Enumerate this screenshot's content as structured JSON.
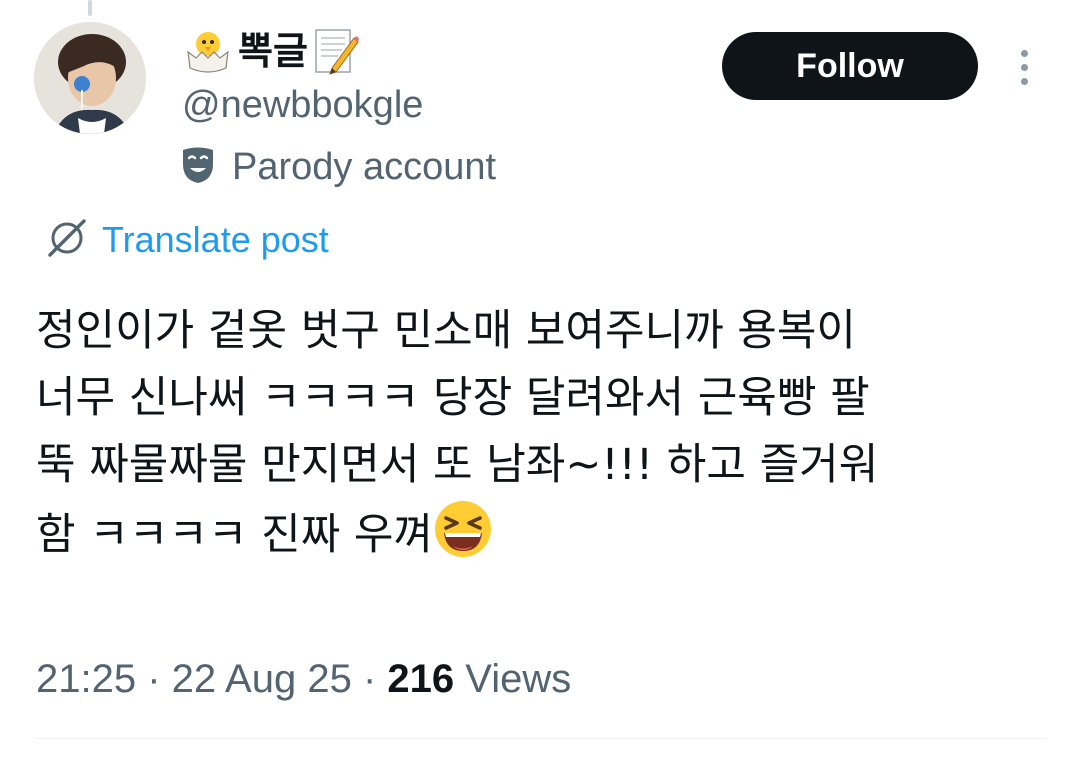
{
  "author": {
    "display_name": "뽁글",
    "handle": "@newbbokgle",
    "account_label": "Parody account",
    "name_emoji_left": "hatching-chick-icon",
    "name_emoji_right": "memo-icon"
  },
  "actions": {
    "follow_label": "Follow"
  },
  "translate": {
    "label": "Translate post"
  },
  "post": {
    "lines": [
      "정인이가 겉옷 벗구 민소매 보여주니까 용복이",
      "너무 신나써 ㅋㅋㅋㅋ 당장 달려와서 근육빵 팔",
      "뚝 짜물짜물 만지면서 또 남좌~!!! 하고 즐거워",
      "함 ㅋㅋㅋㅋ 진짜 우껴"
    ],
    "trailing_emoji": "grinning-squinting-face-icon"
  },
  "meta": {
    "time": "21:25",
    "separator": " · ",
    "date": "22 Aug 25",
    "views_count": "216",
    "views_label": " Views"
  },
  "colors": {
    "text_primary": "#0f1419",
    "text_secondary": "#536471",
    "link": "#1d9bf0",
    "follow_bg": "#0f1419",
    "divider": "#eff3f4"
  }
}
